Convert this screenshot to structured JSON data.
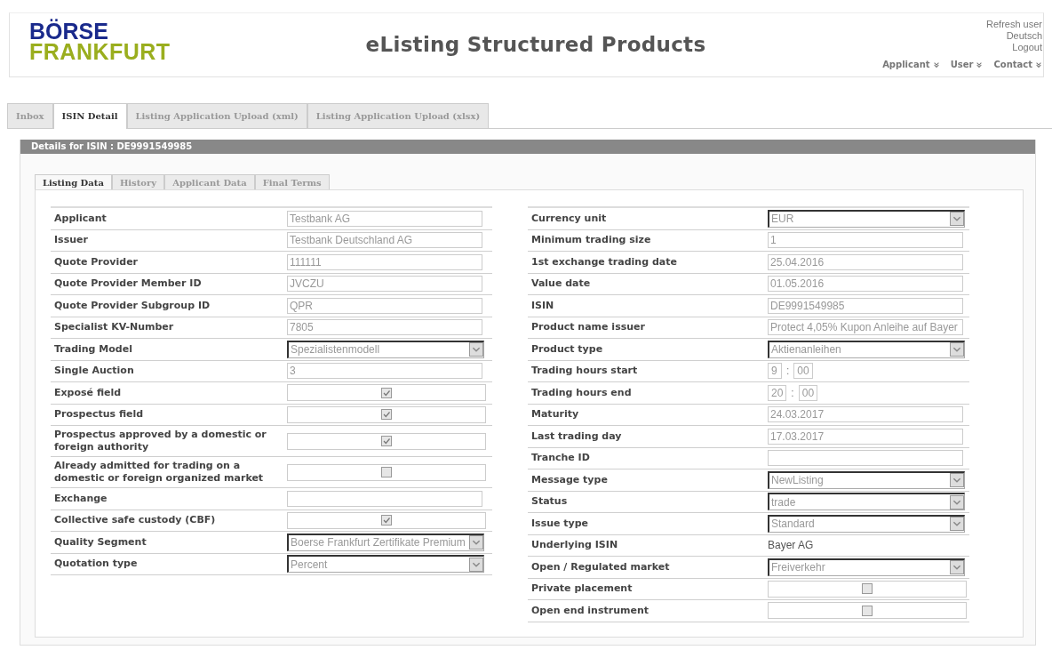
{
  "header": {
    "logo": {
      "line_1": "BÖRSE",
      "line_2": "FRANKFURT"
    },
    "title": "eListing Structured Products",
    "links": [
      "Refresh user",
      "Deutsch",
      "Logout"
    ],
    "menus": [
      "Applicant",
      "User",
      "Contact"
    ]
  },
  "tabs": [
    {
      "label": "Inbox",
      "selected": false
    },
    {
      "label": "ISIN Detail",
      "selected": true
    },
    {
      "label": "Listing Application Upload (xml)",
      "selected": false
    },
    {
      "label": "Listing Application Upload (xlsx)",
      "selected": false
    }
  ],
  "panel": {
    "title": "Details for ISIN : DE9991549985",
    "tabs": [
      {
        "label": "Listing Data",
        "selected": true
      },
      {
        "label": "History",
        "selected": false
      },
      {
        "label": "Applicant Data",
        "selected": false
      },
      {
        "label": "Final Terms",
        "selected": false
      }
    ],
    "left_fields": [
      {
        "label": "Applicant",
        "kind": "text",
        "value": "Testbank AG"
      },
      {
        "label": "Issuer",
        "kind": "text",
        "value": "Testbank Deutschland AG"
      },
      {
        "label": "Quote Provider",
        "kind": "text",
        "value": "111111"
      },
      {
        "label": "Quote Provider Member ID",
        "kind": "text",
        "value": "JVCZU"
      },
      {
        "label": "Quote Provider Subgroup ID",
        "kind": "text",
        "value": "QPR"
      },
      {
        "label": "Specialist KV-Number",
        "kind": "text",
        "value": "7805"
      },
      {
        "label": "Trading Model",
        "kind": "select",
        "value": "Spezialistenmodell"
      },
      {
        "label": "Single Auction",
        "kind": "text",
        "value": "3"
      },
      {
        "label": "Exposé field",
        "kind": "checkbox",
        "checked": true
      },
      {
        "label": "Prospectus field",
        "kind": "checkbox",
        "checked": true
      },
      {
        "label": "Prospectus approved by a domestic or foreign authority",
        "kind": "checkbox",
        "checked": true
      },
      {
        "label": "Already admitted for trading on a domestic or foreign organized market",
        "kind": "checkbox",
        "checked": false
      },
      {
        "label": "Exchange",
        "kind": "text"
      },
      {
        "label": "Collective safe custody (CBF)",
        "kind": "checkbox",
        "checked": true
      },
      {
        "label": "Quality Segment",
        "kind": "select",
        "value": "Boerse Frankfurt Zertifikate Premium"
      },
      {
        "label": "Quotation type",
        "kind": "select",
        "value": "Percent"
      }
    ],
    "right_fields": [
      {
        "label": "Currency unit",
        "kind": "select",
        "value": "EUR"
      },
      {
        "label": "Minimum trading size",
        "kind": "text",
        "value": "1"
      },
      {
        "label": "1st exchange trading date",
        "kind": "text",
        "value": "25.04.2016"
      },
      {
        "label": "Value date",
        "kind": "text",
        "value": "01.05.2016"
      },
      {
        "label": "ISIN",
        "kind": "text",
        "value": "DE9991549985"
      },
      {
        "label": "Product name issuer",
        "kind": "text",
        "value": "Protect 4,05% Kupon Anleihe auf Bayer"
      },
      {
        "label": "Product type",
        "kind": "select",
        "value": "Aktienanleihen"
      },
      {
        "label": "Trading hours start",
        "kind": "time",
        "hours": "9",
        "separator": ":",
        "minutes": "00"
      },
      {
        "label": "Trading hours end",
        "kind": "time",
        "hours": "20",
        "separator": ":",
        "minutes": "00"
      },
      {
        "label": "Maturity",
        "kind": "text",
        "value": "24.03.2017"
      },
      {
        "label": "Last trading day",
        "kind": "text",
        "value": "17.03.2017"
      },
      {
        "label": "Tranche ID",
        "kind": "text"
      },
      {
        "label": "Message type",
        "kind": "select",
        "value": "NewListing"
      },
      {
        "label": "Status",
        "kind": "select",
        "value": "trade"
      },
      {
        "label": "Issue type",
        "kind": "select",
        "value": "Standard"
      },
      {
        "label": "Underlying ISIN",
        "kind": "plain",
        "value": "Bayer AG"
      },
      {
        "label": "Open / Regulated market",
        "kind": "select",
        "value": "Freiverkehr"
      },
      {
        "label": "Private placement",
        "kind": "checkbox",
        "checked": false
      },
      {
        "label": "Open end instrument",
        "kind": "checkbox",
        "checked": false
      }
    ]
  }
}
